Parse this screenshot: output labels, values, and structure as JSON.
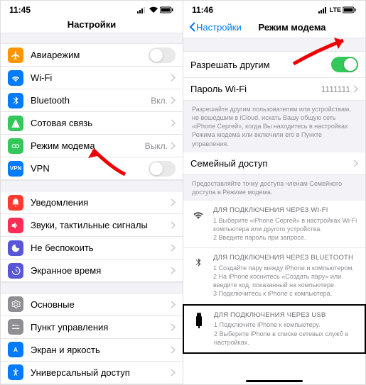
{
  "left": {
    "time": "11:45",
    "title": "Настройки",
    "rows": {
      "airplane": {
        "label": "Авиарежим",
        "color": "#ff9500"
      },
      "wifi": {
        "label": "Wi-Fi",
        "value": "",
        "color": "#007aff"
      },
      "bt": {
        "label": "Bluetooth",
        "value": "Вкл.",
        "color": "#007aff"
      },
      "cell": {
        "label": "Сотовая связь",
        "color": "#34c759"
      },
      "hotspot": {
        "label": "Режим модема",
        "value": "Выкл.",
        "color": "#34c759"
      },
      "vpn": {
        "label": "VPN",
        "color": "#007aff"
      },
      "notif": {
        "label": "Уведомления",
        "color": "#ff3b30"
      },
      "sounds": {
        "label": "Звуки, тактильные сигналы",
        "color": "#ff3b30"
      },
      "dnd": {
        "label": "Не беспокоить",
        "color": "#5856d6"
      },
      "screentime": {
        "label": "Экранное время",
        "color": "#5856d6"
      },
      "general": {
        "label": "Основные",
        "color": "#8e8e93"
      },
      "control": {
        "label": "Пункт управления",
        "color": "#8e8e93"
      },
      "display": {
        "label": "Экран и яркость",
        "color": "#007aff"
      },
      "access": {
        "label": "Универсальный доступ",
        "color": "#007aff"
      }
    }
  },
  "right": {
    "time": "11:46",
    "carrier": "LTE",
    "back": "Настройки",
    "title": "Режим модема",
    "allow": {
      "label": "Разрешать другим"
    },
    "password": {
      "label": "Пароль Wi-Fi",
      "value": "1111111"
    },
    "desc": "Разрешайте другим пользователям или устройствам, не вошедшим в iCloud, искать Вашу общую сеть «iPhone Сергей», когда Вы находитесь в настройках Режима модема или включили его в Пункте управления.",
    "family": {
      "label": "Семейный доступ"
    },
    "family_desc": "Предоставляйте точку доступа членам Семейного доступа в Режиме модема.",
    "wifi": {
      "title": "ДЛЯ ПОДКЛЮЧЕНИЯ ЧЕРЕЗ WI-FI",
      "l1": "1 Выберите «iPhone Сергей» в настройках Wi-Fi компьютера или другого устройства.",
      "l2": "2 Введите пароль при запросе."
    },
    "bt": {
      "title": "ДЛЯ ПОДКЛЮЧЕНИЯ ЧЕРЕЗ BLUETOOTH",
      "l1": "1 Создайте пару между iPhone и компьютером.",
      "l2": "2 На iPhone коснитесь «Создать пару» или введите код, показанный на компьютере.",
      "l3": "3 Подключитесь к iPhone с компьютера."
    },
    "usb": {
      "title": "ДЛЯ ПОДКЛЮЧЕНИЯ ЧЕРЕЗ USB",
      "l1": "1 Подключите iPhone к компьютеру.",
      "l2": "2 Выберите iPhone в списке сетевых служб в настройках."
    }
  }
}
